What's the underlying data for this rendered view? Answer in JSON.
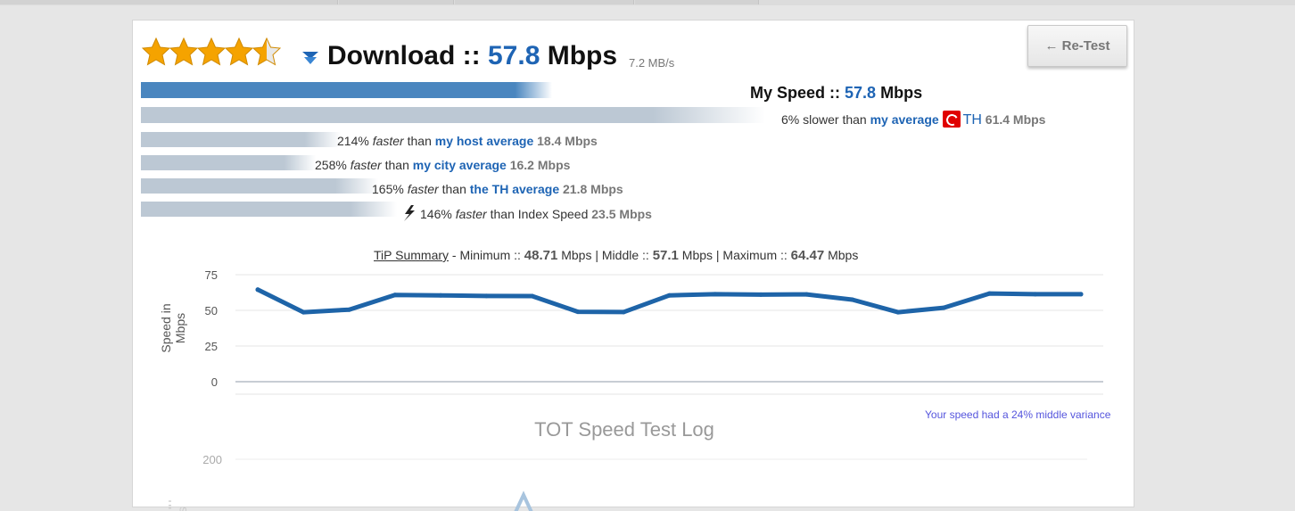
{
  "rating": {
    "stars": 4.5,
    "max": 5
  },
  "download": {
    "label": "Download ::",
    "speed": "57.8",
    "unit": "Mbps",
    "mbs": "7.2 MB/s"
  },
  "retest_label": "← Re-Test",
  "my_speed": {
    "label": "My Speed ::",
    "value": "57.8",
    "unit": "Mbps",
    "bar_fraction": 0.94
  },
  "my_average": {
    "pct": "6% slower than",
    "link": "my average",
    "country": "TH",
    "value": "61.4 Mbps",
    "bar_fraction": 1.0
  },
  "comparisons": [
    {
      "pct": "214%",
      "word": "faster",
      "than": "than",
      "link": "my host average",
      "value": "18.4 Mbps",
      "bar_fraction": 0.32
    },
    {
      "pct": "258%",
      "word": "faster",
      "than": "than",
      "link": "my city average",
      "value": "16.2 Mbps",
      "bar_fraction": 0.28
    },
    {
      "pct": "165%",
      "word": "faster",
      "than": "than",
      "link": "the TH average",
      "value": "21.8 Mbps",
      "bar_fraction": 0.38
    },
    {
      "pct": "146%",
      "word": "faster",
      "than": "than Index Speed",
      "link": "",
      "value": "23.5 Mbps",
      "bar_fraction": 0.41
    }
  ],
  "tip_summary": {
    "link": "TiP Summary",
    "min_label": " - Minimum :: ",
    "min": "48.71",
    "mid_label": " Mbps | Middle :: ",
    "mid": "57.1",
    "max_label": " Mbps | Maximum :: ",
    "max": "64.47",
    "unit": " Mbps"
  },
  "chart_data": [
    {
      "type": "line",
      "title": "",
      "ylabel": "Speed in Mbps",
      "xlabel": "",
      "ylim": [
        0,
        75
      ],
      "yticks": [
        0,
        25,
        50,
        75
      ],
      "grid": true,
      "color": "#1e64a8",
      "x": [
        1,
        2,
        3,
        4,
        5,
        6,
        7,
        8,
        9,
        10,
        11,
        12,
        13,
        14,
        15,
        16,
        17,
        18,
        19
      ],
      "values": [
        64.5,
        48.7,
        50.5,
        60.8,
        60.5,
        60.1,
        60.0,
        49.0,
        48.8,
        60.5,
        61.3,
        61.0,
        61.2,
        57.5,
        48.7,
        51.8,
        61.8,
        61.3,
        61.3
      ]
    },
    {
      "type": "line",
      "title": "TOT Speed Test Log",
      "ylabel": "",
      "yticks": [
        200
      ],
      "grid": true
    }
  ],
  "variance_text": "Your speed had a 24% middle variance",
  "chart2_ytick": "200",
  "colors": {
    "accent": "#1e64b4",
    "bar_blue": "#4a86bf",
    "bar_grey": "#bcc8d4",
    "star": "#f5a300"
  }
}
